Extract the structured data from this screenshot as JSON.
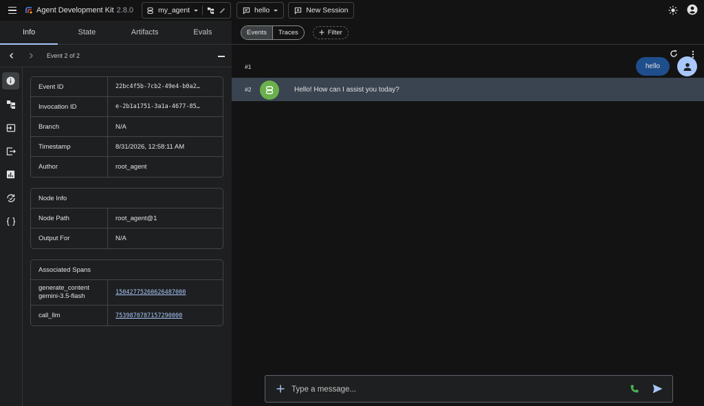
{
  "app": {
    "title": "Agent Development Kit",
    "version": "2.8.0",
    "agent_name": "my_agent",
    "session_name": "hello",
    "new_session_label": "New Session"
  },
  "left_tabs": [
    {
      "label": "Info"
    },
    {
      "label": "State"
    },
    {
      "label": "Artifacts"
    },
    {
      "label": "Evals"
    }
  ],
  "event_nav": {
    "label": "Event 2 of 2"
  },
  "event_details": {
    "rows": [
      {
        "key": "Event ID",
        "value": "22bc4f5b-7cb2-49e4-b0a2…"
      },
      {
        "key": "Invocation ID",
        "value": "e-2b1a1751-3a1a-4677-85…"
      },
      {
        "key": "Branch",
        "value": "N/A"
      },
      {
        "key": "Timestamp",
        "value": "8/31/2026, 12:58:11 AM"
      },
      {
        "key": "Author",
        "value": "root_agent"
      }
    ]
  },
  "node_info": {
    "title": "Node Info",
    "rows": [
      {
        "key": "Node Path",
        "value": "root_agent@1"
      },
      {
        "key": "Output For",
        "value": "N/A"
      }
    ]
  },
  "spans": {
    "title": "Associated Spans",
    "rows": [
      {
        "key_line1": "generate_content",
        "key_line2": "gemini-3.5-flash",
        "value": "15042775260626487000"
      },
      {
        "key": "call_llm",
        "value": "7539870787157290000"
      }
    ]
  },
  "toolbar": {
    "events_label": "Events",
    "traces_label": "Traces",
    "filter_label": "Filter"
  },
  "messages": [
    {
      "num": "#1",
      "text": "hello"
    },
    {
      "num": "#2",
      "text": "Hello! How can I assist you today?"
    }
  ],
  "composer": {
    "placeholder": "Type a message..."
  },
  "icons": {
    "menu": "menu-icon",
    "logo": "adk-logo-icon",
    "agent": "agent-icon",
    "graph": "graph-icon",
    "edit": "pencil-icon",
    "chat": "chat-icon",
    "new_session": "add-chat-icon",
    "theme": "sun-icon",
    "account": "account-circle-icon",
    "info": "info-icon",
    "refresh": "refresh-icon",
    "more": "more-vert-icon",
    "add": "plus-icon",
    "phone": "phone-icon",
    "send": "send-icon"
  },
  "colors": {
    "accent": "#a8c7fa",
    "user_bubble": "#1f4e8c",
    "bot_avatar": "#6ab04c",
    "selected_row": "#3a4350",
    "phone": "#4caf50"
  }
}
